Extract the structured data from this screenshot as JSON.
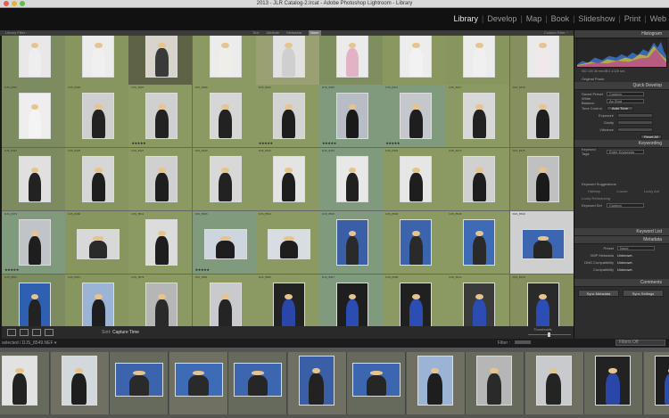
{
  "window": {
    "title": "2013 - JLR Catalog-2.lrcat - Adobe Photoshop Lightroom - Library"
  },
  "modules": [
    "Library",
    "Develop",
    "Map",
    "Book",
    "Slideshow",
    "Print",
    "Web"
  ],
  "active_module": "Library",
  "filter_bar": {
    "label": "Library Filter :",
    "options": [
      "Text",
      "Attribute",
      "Metadata",
      "None"
    ],
    "active": "None",
    "preset": "Custom Filter ÷"
  },
  "grid": {
    "rows": [
      [
        {
          "caption": "",
          "bg": "#e8e8e8",
          "outfit": "#eeeeee",
          "cell": "#7c8c60",
          "stars": ""
        },
        {
          "caption": "",
          "bg": "#ececec",
          "outfit": "#f0f0f0",
          "cell": "#87965f",
          "stars": ""
        },
        {
          "caption": "",
          "bg": "#d8d4cc",
          "outfit": "#3a3a3a",
          "cell": "#5e6346",
          "stars": ""
        },
        {
          "caption": "",
          "bg": "#ececec",
          "outfit": "#f0eee8",
          "cell": "#8b9963",
          "stars": ""
        },
        {
          "caption": "",
          "bg": "#e2e2e2",
          "outfit": "#cfcfcf",
          "cell": "#9aa072",
          "stars": ""
        },
        {
          "caption": "",
          "bg": "#ebebeb",
          "outfit": "#e3b3c5",
          "cell": "#7e8e5e",
          "stars": ""
        },
        {
          "caption": "",
          "bg": "#ededed",
          "outfit": "#f2f2f2",
          "cell": "#8a9860",
          "stars": ""
        },
        {
          "caption": "",
          "bg": "#ececec",
          "outfit": "#f0f0f0",
          "cell": "#87965f",
          "stars": ""
        },
        {
          "caption": "",
          "bg": "#eaeaea",
          "outfit": "#f0e8ea",
          "cell": "#86905f",
          "stars": ""
        }
      ],
      [
        {
          "caption": "DJS_8391",
          "bg": "#eeeeee",
          "outfit": "#f4f4f4",
          "cell": "#7c8c60",
          "stars": ""
        },
        {
          "caption": "DJS_8396",
          "bg": "#cfcfcf",
          "outfit": "#222222",
          "cell": "#87965f",
          "stars": ""
        },
        {
          "caption": "DJS_8397",
          "bg": "#d0d0d0",
          "outfit": "#222222",
          "cell": "#8b9963",
          "stars": "★★★★★"
        },
        {
          "caption": "DJS_8399",
          "bg": "#d6d6d6",
          "outfit": "#222222",
          "cell": "#8b9963",
          "stars": ""
        },
        {
          "caption": "DJS_8402",
          "bg": "#d3d3d3",
          "outfit": "#1e1e1e",
          "cell": "#8b9963",
          "stars": "★★★★★"
        },
        {
          "caption": "DJS_8405",
          "bg": "#b8bcc4",
          "outfit": "#1a1a1a",
          "cell": "#7f9a7d",
          "stars": "★★★★★"
        },
        {
          "caption": "DJS_8412",
          "bg": "#c4c8cc",
          "outfit": "#1e1e1e",
          "cell": "#7f9a7d",
          "stars": "★★★★★"
        },
        {
          "caption": "DJS_8417",
          "bg": "#d8d8d8",
          "outfit": "#222222",
          "cell": "#8b9963",
          "stars": ""
        },
        {
          "caption": "DJS_8418",
          "bg": "#d4d4d4",
          "outfit": "#1e1e1e",
          "cell": "#86905f",
          "stars": ""
        }
      ],
      [
        {
          "caption": "DJS_8420",
          "bg": "#e0e0e0",
          "outfit": "#222222",
          "cell": "#7c8c60",
          "stars": ""
        },
        {
          "caption": "DJS_8425",
          "bg": "#d6d6d6",
          "outfit": "#1e1e1e",
          "cell": "#87965f",
          "stars": ""
        },
        {
          "caption": "DJS_8427",
          "bg": "#d0d0d0",
          "outfit": "#1e1e1e",
          "cell": "#8b9963",
          "stars": ""
        },
        {
          "caption": "DJS_8430",
          "bg": "#d8d8d8",
          "outfit": "#222222",
          "cell": "#8b9963",
          "stars": ""
        },
        {
          "caption": "DJS_8434",
          "bg": "#e4e4e4",
          "outfit": "#1e1e1e",
          "cell": "#8b9963",
          "stars": ""
        },
        {
          "caption": "DJS_8445",
          "bg": "#e8e8e8",
          "outfit": "#202020",
          "cell": "#7f9a7d",
          "stars": ""
        },
        {
          "caption": "DJS_8464",
          "bg": "#e6e6e6",
          "outfit": "#1e1e1e",
          "cell": "#8b9963",
          "stars": ""
        },
        {
          "caption": "DJS_8472",
          "bg": "#d0d0d0",
          "outfit": "#1e1e1e",
          "cell": "#8b9963",
          "stars": ""
        },
        {
          "caption": "DJS_8475",
          "bg": "#c0c0c0",
          "outfit": "#1a1a1a",
          "cell": "#86905f",
          "stars": ""
        }
      ],
      [
        {
          "caption": "DJS_8479",
          "bg": "#c0c4c6",
          "outfit": "#1e1e1e",
          "cell": "#7f9a7d",
          "stars": "★★★★★"
        },
        {
          "caption": "DJS_8480",
          "bg": "#d8d8d8",
          "outfit": "#2a2a2a",
          "cell": "#87965f",
          "stars": ""
        },
        {
          "caption": "DJS_8511",
          "bg": "#dcdcdc",
          "outfit": "#1e1e1e",
          "cell": "#8b9963",
          "stars": ""
        },
        {
          "caption": "DJS_8528",
          "bg": "#cdd6de",
          "outfit": "#1e1e1e",
          "cell": "#7f9a7d",
          "stars": "★★★★★"
        },
        {
          "caption": "DJS_8533",
          "bg": "#d8dde2",
          "outfit": "#1e1e1e",
          "cell": "#8b9963",
          "stars": ""
        },
        {
          "caption": "DJS_8545",
          "bg": "#3a5fa6",
          "outfit": "#2a2a2a",
          "cell": "#7f9a7d",
          "stars": ""
        },
        {
          "caption": "DJS_8546",
          "bg": "#3b64ad",
          "outfit": "#2a2a2a",
          "cell": "#8b9963",
          "stars": ""
        },
        {
          "caption": "DJS_8548",
          "bg": "#3e6bb6",
          "outfit": "#2a2a2a",
          "cell": "#8b9963",
          "stars": ""
        },
        {
          "caption": "DJS_8549",
          "bg": "#3c66b0",
          "outfit": "#262626",
          "cell": "#cfcfcf",
          "stars": ""
        }
      ],
      [
        {
          "caption": "DJS_8563",
          "bg": "#2f5fb0",
          "outfit": "#222222",
          "cell": "#7c8c60",
          "stars": ""
        },
        {
          "caption": "DJS_8567",
          "bg": "#9bb4d6",
          "outfit": "#1e1e1e",
          "cell": "#87965f",
          "stars": ""
        },
        {
          "caption": "DJS_8578",
          "bg": "#b6b6b6",
          "outfit": "#2a2a2a",
          "cell": "#8b9963",
          "stars": ""
        },
        {
          "caption": "DJS_8581",
          "bg": "#c8cace",
          "outfit": "#242424",
          "cell": "#8b9963",
          "stars": ""
        },
        {
          "caption": "DJS_8586",
          "bg": "#222222",
          "outfit": "#2a46a8",
          "cell": "#8b9963",
          "stars": ""
        },
        {
          "caption": "DJS_8597",
          "bg": "#1e1e1e",
          "outfit": "#2b4cb0",
          "cell": "#7f9a7d",
          "stars": ""
        },
        {
          "caption": "DJS_8598",
          "bg": "#202020",
          "outfit": "#2c4db3",
          "cell": "#8b9963",
          "stars": ""
        },
        {
          "caption": "DJS_8612",
          "bg": "#3a3a3a",
          "outfit": "#2b4cb0",
          "cell": "#8b9963",
          "stars": ""
        },
        {
          "caption": "DJS_8618",
          "bg": "#2a2a2a",
          "outfit": "#2c4db3",
          "cell": "#86905f",
          "stars": ""
        }
      ]
    ]
  },
  "grid_toolbar": {
    "sort_label": "Sort:",
    "sort_value": "Capture Time",
    "thumbnails_label": "Thumbnails"
  },
  "right_panel": {
    "histogram": {
      "title": "Histogram",
      "info": "ISO 100   35 mm   f/8.0   1/125 sec",
      "original_photo": "Original Photo"
    },
    "quick_develop": {
      "title": "Quick Develop",
      "saved_preset_label": "Saved Preset",
      "saved_preset_value": "Custom",
      "white_balance_label": "White Balance",
      "white_balance_value": "As Shot",
      "tone_control_label": "Tone Control",
      "auto_tone_label": "Auto Tone",
      "exposure_label": "Exposure",
      "clarity_label": "Clarity",
      "vibrance_label": "Vibrance",
      "reset_all_label": "Reset All"
    },
    "keywording": {
      "title": "Keywording",
      "keyword_tags_label": "Keyword Tags",
      "keyword_tags_value": "Enter Keywords",
      "suggestions_label": "Keyword Suggestions",
      "suggestions": [
        "Hallway",
        "Louvre",
        "Lucky Ani",
        "Lucky Rehearsing"
      ],
      "keyword_set_label": "Keyword Set",
      "keyword_set_value": "Custom"
    },
    "keyword_list": {
      "title": "Keyword List"
    },
    "metadata": {
      "title": "Metadata",
      "preset_label": "Preset",
      "preset_value": "None",
      "rows": [
        {
          "label": "XMP Metadata",
          "value": "Unknown"
        },
        {
          "label": "DNG Compatibility",
          "value": "Unknown"
        },
        {
          "label": "Compatibility",
          "value": "Unknown"
        }
      ]
    },
    "comments": {
      "title": "Comments"
    },
    "sync_metadata_label": "Sync Metadata",
    "sync_settings_label": "Sync Settings"
  },
  "filmstrip_bar": {
    "selected_text": "selected / DJS_8549.NEF ▾",
    "filter_label": "Filter :",
    "filter_value": "Filters Off"
  },
  "filmstrip": [
    {
      "bg": "#e2e2e2",
      "outfit": "#222222"
    },
    {
      "bg": "#d2d8dc",
      "outfit": "#1e1e1e"
    },
    {
      "bg": "#3b64ad",
      "outfit": "#2a2a2a"
    },
    {
      "bg": "#3e6bb6",
      "outfit": "#2a2a2a"
    },
    {
      "bg": "#3c66b0",
      "outfit": "#262626"
    },
    {
      "bg": "#3a5fa6",
      "outfit": "#222222"
    },
    {
      "bg": "#3c66b0",
      "outfit": "#262626"
    },
    {
      "bg": "#9bb4d6",
      "outfit": "#1e1e1e"
    },
    {
      "bg": "#b6b6b6",
      "outfit": "#2a2a2a"
    },
    {
      "bg": "#c8cace",
      "outfit": "#242424"
    },
    {
      "bg": "#222222",
      "outfit": "#2a46a8"
    },
    {
      "bg": "#1e1e1e",
      "outfit": "#2b4cb0"
    }
  ],
  "colors": {
    "accent": "#e8e8e8",
    "panel": "#2d2d2d",
    "grid_cell_light": "#8b9963",
    "grid_cell_green": "#7f9a7d"
  }
}
